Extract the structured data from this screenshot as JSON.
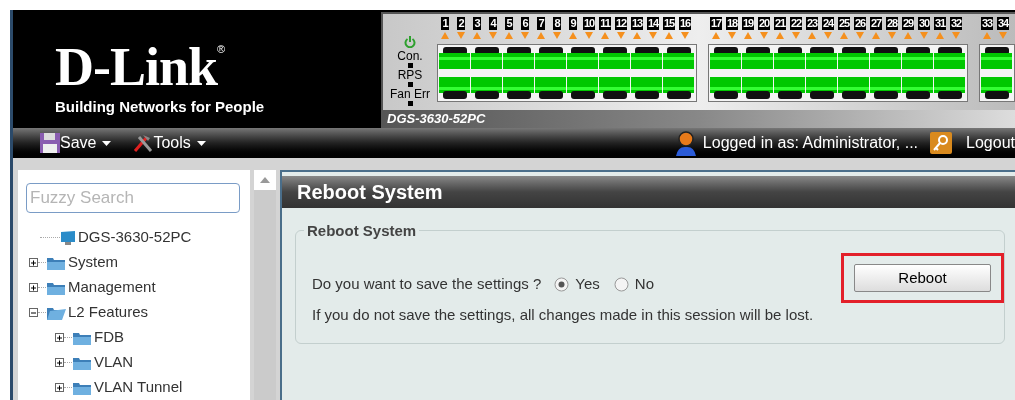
{
  "brand": {
    "logo": "D-Link",
    "registered": "®",
    "tagline": "Building Networks for People"
  },
  "device": {
    "model": "DGS-3630-52PC",
    "indicators": [
      "Con.",
      "RPS",
      "Fan Err"
    ],
    "port_groups": [
      [
        "1",
        "2",
        "3",
        "4",
        "5",
        "6",
        "7",
        "8",
        "9",
        "10",
        "11",
        "12",
        "13",
        "14",
        "15",
        "16"
      ],
      [
        "17",
        "18",
        "19",
        "20",
        "21",
        "22",
        "23",
        "24",
        "25",
        "26",
        "27",
        "28",
        "29",
        "30",
        "31",
        "32"
      ],
      [
        "33",
        "34"
      ]
    ]
  },
  "toolbar": {
    "menus": [
      {
        "label": "Save",
        "kind": "save"
      },
      {
        "label": "Tools",
        "kind": "tools"
      }
    ],
    "user": "Logged in as: Administrator, ...",
    "logout": "Logout"
  },
  "sidebar": {
    "search": {
      "placeholder": "Fuzzy Search"
    },
    "tree": [
      {
        "label": "DGS-3630-52PC",
        "kind": "device"
      },
      {
        "label": "System",
        "kind": "folder",
        "expanded": false
      },
      {
        "label": "Management",
        "kind": "folder",
        "expanded": false
      },
      {
        "label": "L2 Features",
        "kind": "folder",
        "expanded": true,
        "children": [
          {
            "label": "FDB",
            "kind": "folder",
            "expanded": false
          },
          {
            "label": "VLAN",
            "kind": "folder",
            "expanded": false
          },
          {
            "label": "VLAN Tunnel",
            "kind": "folder",
            "expanded": false
          }
        ]
      }
    ]
  },
  "page": {
    "title": "Reboot System",
    "legend": "Reboot System",
    "question": "Do you want to save the settings ?",
    "options": [
      {
        "label": "Yes",
        "selected": true
      },
      {
        "label": "No",
        "selected": false
      }
    ],
    "note": "If you do not save the settings, all changes made in this session will be lost.",
    "button": "Reboot",
    "button_highlighted": true
  }
}
